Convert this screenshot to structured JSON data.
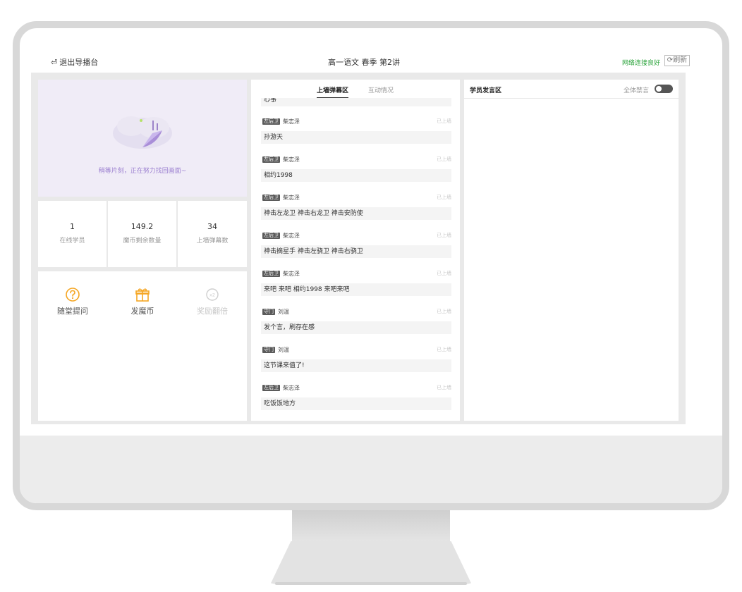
{
  "header": {
    "exit_label": "退出导播台",
    "title": "高一语文 春季 第2讲",
    "network_status": "网络连接良好",
    "refresh_label": "刷新"
  },
  "video": {
    "status_text": "稍等片刻，正在努力找回画面~"
  },
  "stats": [
    {
      "value": "1",
      "label": "在线学员"
    },
    {
      "value": "149.2",
      "label": "魔币剩余数量"
    },
    {
      "value": "34",
      "label": "上墙弹幕数"
    }
  ],
  "actions": [
    {
      "label": "随堂提问",
      "enabled": true
    },
    {
      "label": "发魔币",
      "enabled": true
    },
    {
      "label": "奖励翻倍",
      "enabled": false
    }
  ],
  "danmu": {
    "tabs": [
      "上墙弹幕区",
      "互动情况"
    ],
    "active_tab": "上墙弹幕区",
    "first_message": "心事",
    "messages": [
      {
        "role": "左后卫",
        "name": "柴志泽",
        "state": "已上墙",
        "text": "孙游天"
      },
      {
        "role": "左后卫",
        "name": "柴志泽",
        "state": "已上墙",
        "text": "相约1998"
      },
      {
        "role": "左后卫",
        "name": "柴志泽",
        "state": "已上墙",
        "text": "神击左龙卫 神击右龙卫 神击安防使"
      },
      {
        "role": "左后卫",
        "name": "柴志泽",
        "state": "已上墙",
        "text": "神击摘星手 神击左骁卫 神击右骁卫"
      },
      {
        "role": "左后卫",
        "name": "柴志泽",
        "state": "已上墙",
        "text": "来吧 来吧 相约1998 来吧来吧"
      },
      {
        "role": "守门",
        "name": "刘温",
        "state": "已上墙",
        "text": "发个言，刷存在感"
      },
      {
        "role": "守门",
        "name": "刘温",
        "state": "已上墙",
        "text": "这节课来值了!"
      },
      {
        "role": "左后卫",
        "name": "柴志泽",
        "state": "已上墙",
        "text": "吃饭饭地方"
      }
    ]
  },
  "speech": {
    "title": "学员发言区",
    "mute_all_label": "全体禁言",
    "mute_all_on": false
  },
  "colors": {
    "network_ok": "#2aa33a",
    "accent_orange": "#f5a623",
    "video_bg": "#f0ecf7",
    "video_text": "#9b7fd0"
  }
}
